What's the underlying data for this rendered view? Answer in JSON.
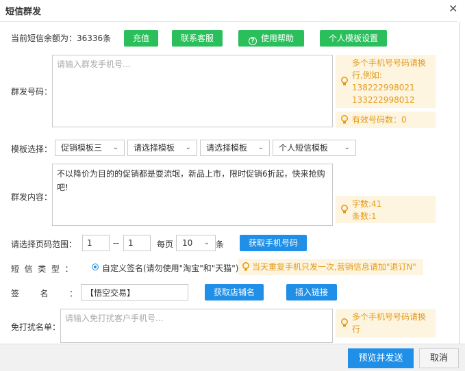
{
  "dialog": {
    "title": "短信群发"
  },
  "balance": {
    "label": "当前短信余额为：36336条"
  },
  "top_buttons": {
    "recharge": "充值",
    "contact": "联系客服",
    "help": "使用帮助",
    "template_settings": "个人模板设置"
  },
  "numbers": {
    "label": "群发号码：",
    "placeholder": "请输入群发手机号...",
    "tip_lines": [
      "多个手机号号码请换",
      "行,例如:",
      "138222998021",
      "133222998012"
    ],
    "valid_count": "有效号码数：0"
  },
  "templates": {
    "label": "模板选择：",
    "selects": [
      "促销模板三",
      "请选择模板",
      "请选择模板",
      "个人短信模板"
    ]
  },
  "content": {
    "label": "群发内容：",
    "text": "不以降价为目的的促销都是耍流氓，新品上市，限时促销6折起，快来抢购吧!",
    "char_count": "字数:41",
    "msg_count": "条数:1"
  },
  "page_range": {
    "label": "请选择页码范围：",
    "from": "1",
    "separator": "--",
    "to": "1",
    "per_page_label": "每页",
    "per_page_value": "10",
    "unit": "条",
    "fetch_button": "获取手机号码"
  },
  "sms_type": {
    "label": "短  信  类  型  ：",
    "option": "自定义签名(请勿使用\"淘宝\"和\"天猫\")",
    "tip": "当天重复手机只发一次,营销信息请加\"退订N\""
  },
  "signature": {
    "label": "签        名        ：",
    "value": "【悟空交易】",
    "fetch_shop_button": "获取店铺名",
    "insert_link_button": "插入链接"
  },
  "dnd": {
    "label": "免打扰名单：",
    "placeholder": "请输入免打扰客户手机号...",
    "tip_lines": [
      "多个手机号号码请换",
      "行"
    ]
  },
  "footer": {
    "send_button": "预览并发送",
    "cancel_button": "取消"
  },
  "colors": {
    "green": "#2bbf5b",
    "blue": "#1f8fe8",
    "tip_bg": "#fdf5e0",
    "tip_text": "#e69a1c"
  }
}
